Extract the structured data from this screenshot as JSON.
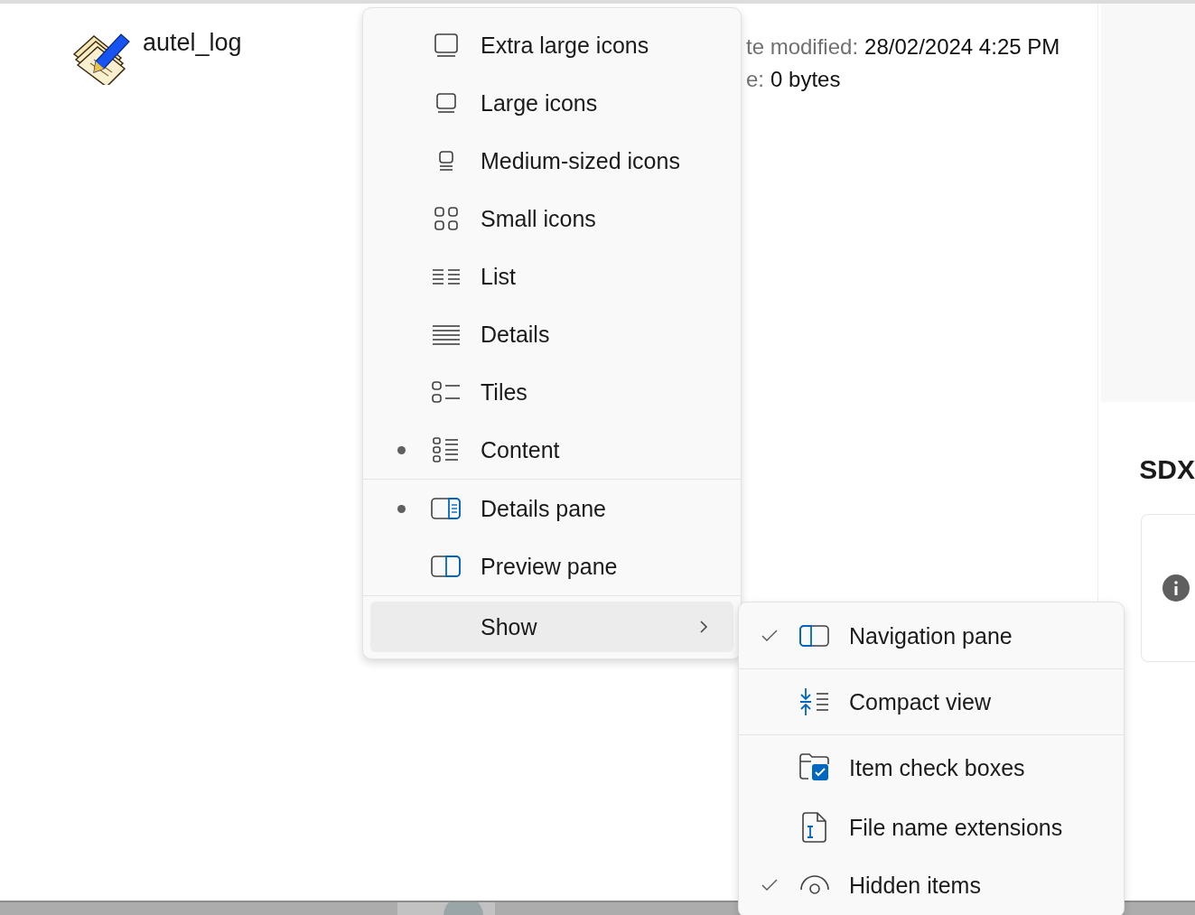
{
  "file": {
    "name": "autel_log"
  },
  "details": [
    {
      "label": "te modified:",
      "value": "28/02/2024 4:25 PM"
    },
    {
      "label": "e:",
      "value": "0 bytes"
    }
  ],
  "side_heading": "SDX",
  "view_menu": {
    "layouts": [
      {
        "label": "Extra large icons",
        "selected": false
      },
      {
        "label": "Large icons",
        "selected": false
      },
      {
        "label": "Medium-sized icons",
        "selected": false
      },
      {
        "label": "Small icons",
        "selected": false
      },
      {
        "label": "List",
        "selected": false
      },
      {
        "label": "Details",
        "selected": false
      },
      {
        "label": "Tiles",
        "selected": false
      },
      {
        "label": "Content",
        "selected": true
      }
    ],
    "panes": [
      {
        "label": "Details pane",
        "selected": true
      },
      {
        "label": "Preview pane",
        "selected": false
      }
    ],
    "show": {
      "label": "Show",
      "expanded": true
    }
  },
  "show_menu": [
    [
      {
        "label": "Navigation pane",
        "checked": true
      }
    ],
    [
      {
        "label": "Compact view",
        "checked": false
      }
    ],
    [
      {
        "label": "Item check boxes",
        "checked": false
      },
      {
        "label": "File name extensions",
        "checked": false
      },
      {
        "label": "Hidden items",
        "checked": true
      }
    ]
  ]
}
